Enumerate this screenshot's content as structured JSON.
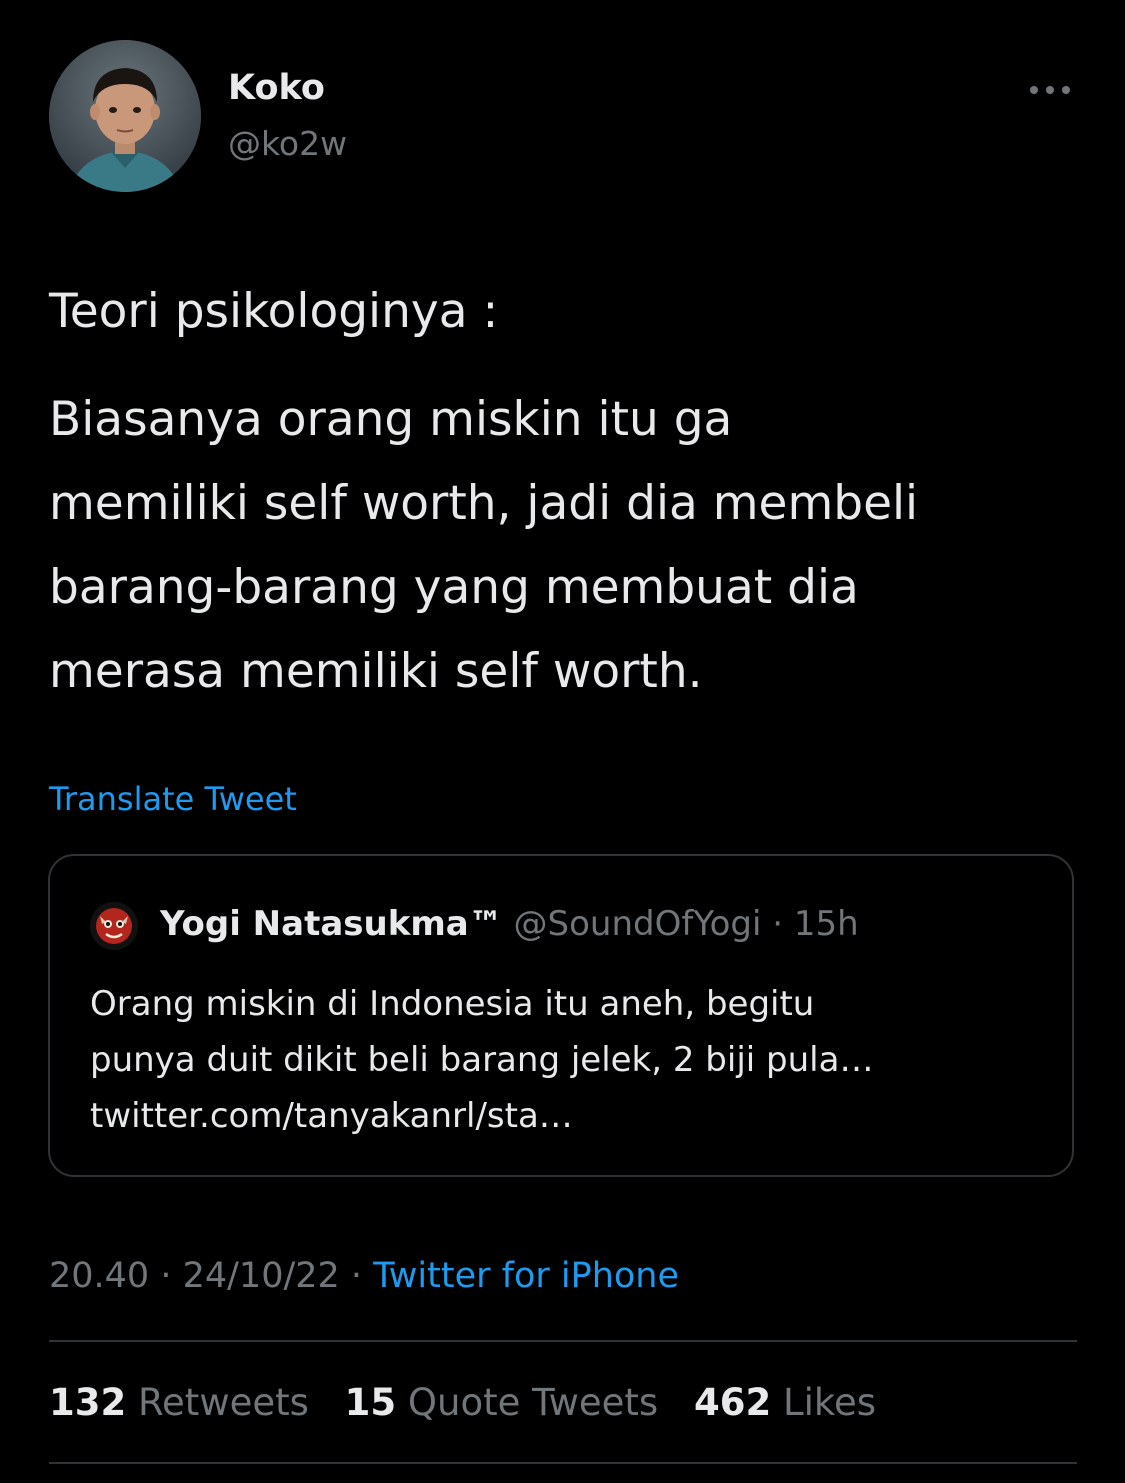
{
  "top_cut_text": "",
  "author": {
    "name": "Koko",
    "handle": "@ko2w"
  },
  "tweet": {
    "paragraphs": [
      [
        "Teori psikologinya :"
      ],
      [
        "Biasanya orang miskin itu ga",
        "memiliki self worth, jadi dia membeli",
        "barang-barang yang membuat dia",
        "merasa memiliki self worth."
      ]
    ],
    "translate_label": "Translate Tweet"
  },
  "quote": {
    "name": "Yogi Natasukma™",
    "handle": "@SoundOfYogi",
    "separator": " · ",
    "time": "15h",
    "lines": [
      "Orang miskin di Indonesia itu aneh, begitu",
      "punya duit dikit beli barang jelek, 2 biji pula…",
      "twitter.com/tanyakanrl/sta…"
    ]
  },
  "meta": {
    "time": "20.40",
    "sep1": " · ",
    "date": "24/10/22",
    "sep2": " · ",
    "source": "Twitter for iPhone"
  },
  "stats": {
    "retweets_count": "132",
    "retweets_label": "Retweets",
    "quotes_count": "15",
    "quotes_label": "Quote Tweets",
    "likes_count": "462",
    "likes_label": "Likes"
  },
  "colors": {
    "background": "#000000",
    "text": "#e7e9ea",
    "secondary": "#71767b",
    "accent": "#1d9bf0",
    "border": "#2f3336"
  },
  "icons": {
    "more": "more-horizontal-icon",
    "avatar": "profile-photo-avatar",
    "quote_avatar": "red-mascot-avatar"
  }
}
